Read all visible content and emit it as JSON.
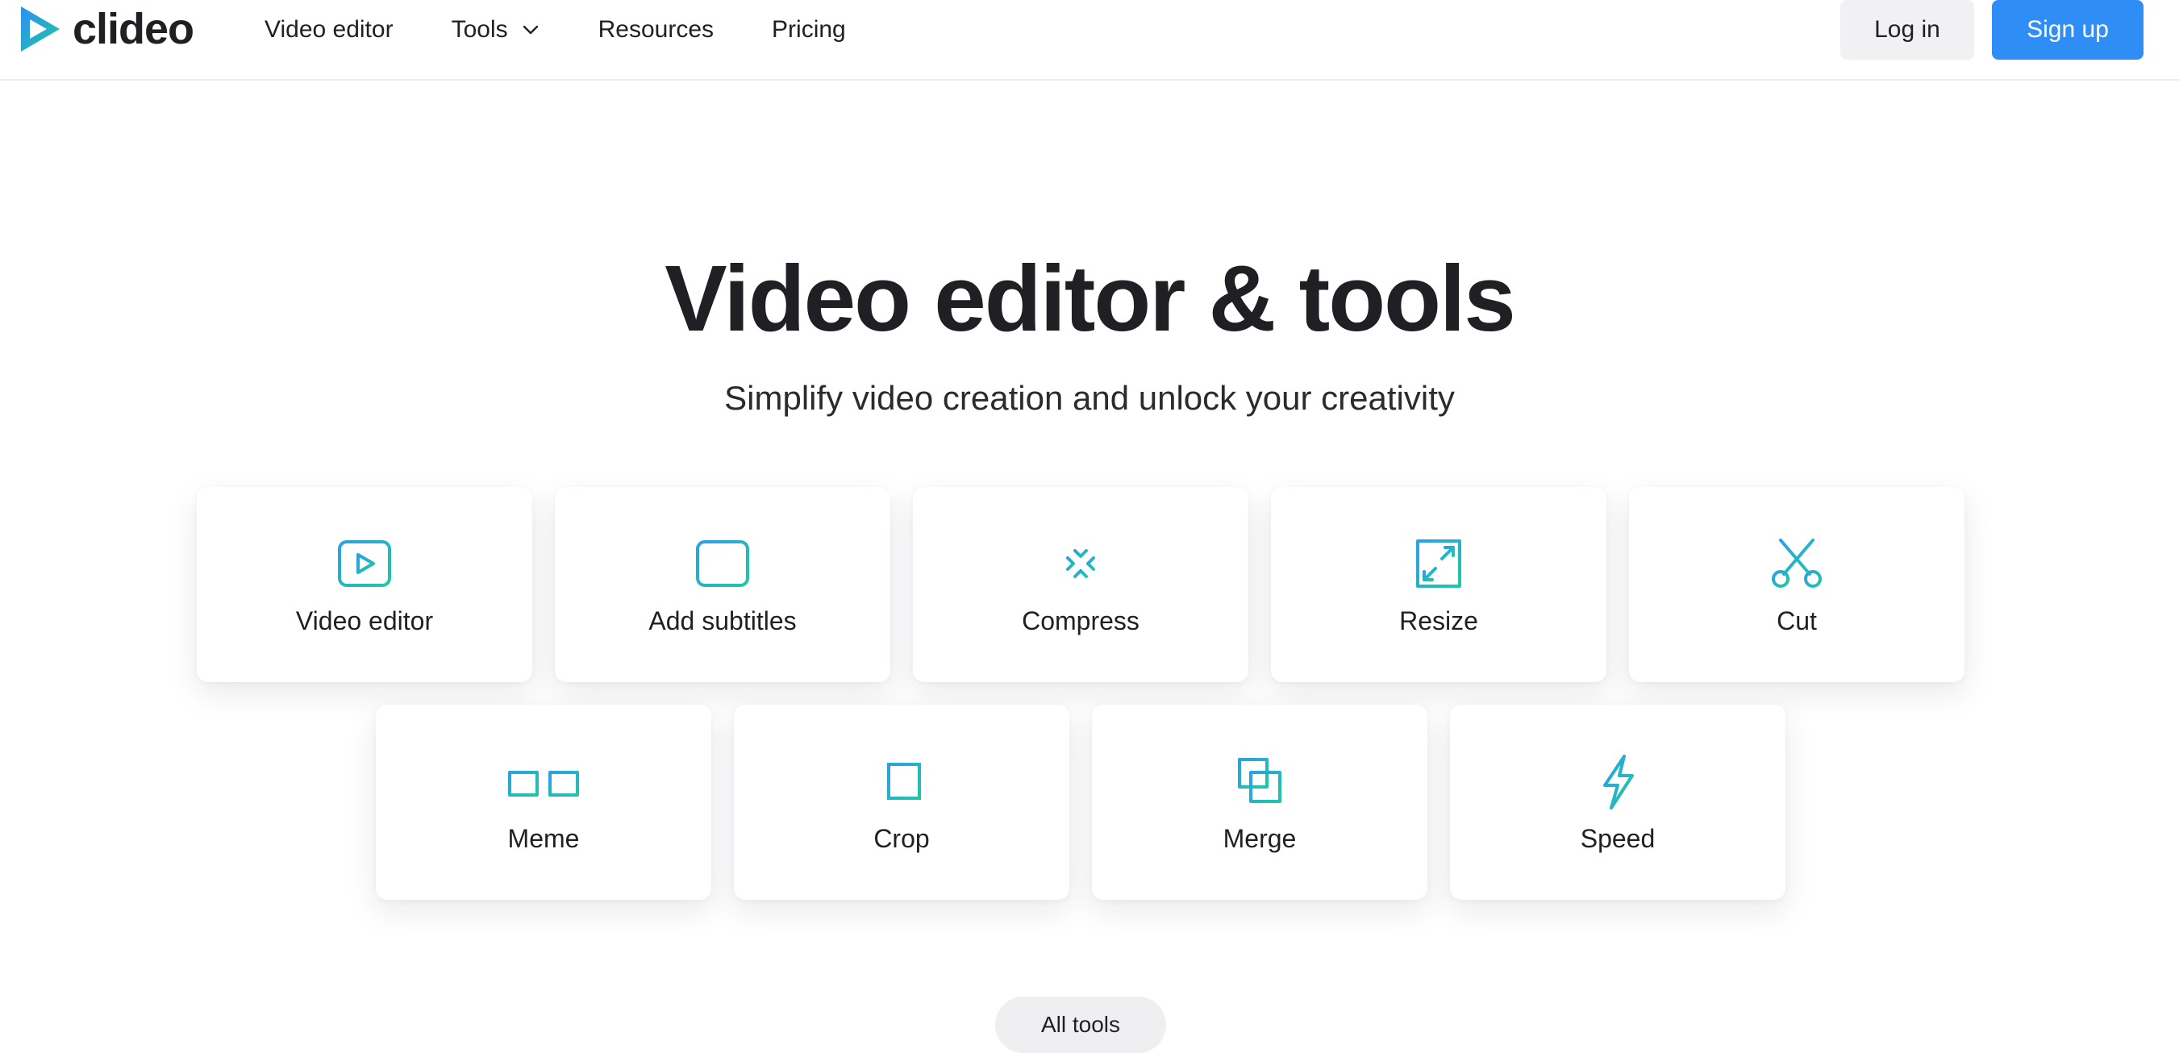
{
  "brand": {
    "name": "clideo",
    "logo_icon": "play-triangle-logo-icon",
    "gradient": [
      "#2f8ef5",
      "#1ec8a5"
    ]
  },
  "nav": {
    "items": [
      {
        "label": "Video editor"
      },
      {
        "label": "Tools",
        "icon": "chevron-down-icon"
      },
      {
        "label": "Resources"
      },
      {
        "label": "Pricing"
      }
    ]
  },
  "auth": {
    "login_label": "Log in",
    "signup_label": "Sign up"
  },
  "colors": {
    "accent": "#2f8ef5",
    "icon_gradient_start": "#2aa0e6",
    "icon_gradient_end": "#1ec8a5"
  },
  "hero": {
    "title": "Video editor & tools",
    "subtitle": "Simplify video creation and unlock your creativity"
  },
  "tools": [
    {
      "label": "Video editor",
      "icon": "play-window-icon"
    },
    {
      "label": "Add subtitles",
      "icon": "subtitles-icon"
    },
    {
      "label": "Compress",
      "icon": "compress-arrows-icon"
    },
    {
      "label": "Resize",
      "icon": "resize-arrows-icon"
    },
    {
      "label": "Cut",
      "icon": "scissors-icon"
    },
    {
      "label": "Meme",
      "icon": "glasses-icon"
    },
    {
      "label": "Crop",
      "icon": "crop-icon"
    },
    {
      "label": "Merge",
      "icon": "merge-squares-icon"
    },
    {
      "label": "Speed",
      "icon": "lightning-icon"
    }
  ],
  "all_tools_label": "All tools"
}
